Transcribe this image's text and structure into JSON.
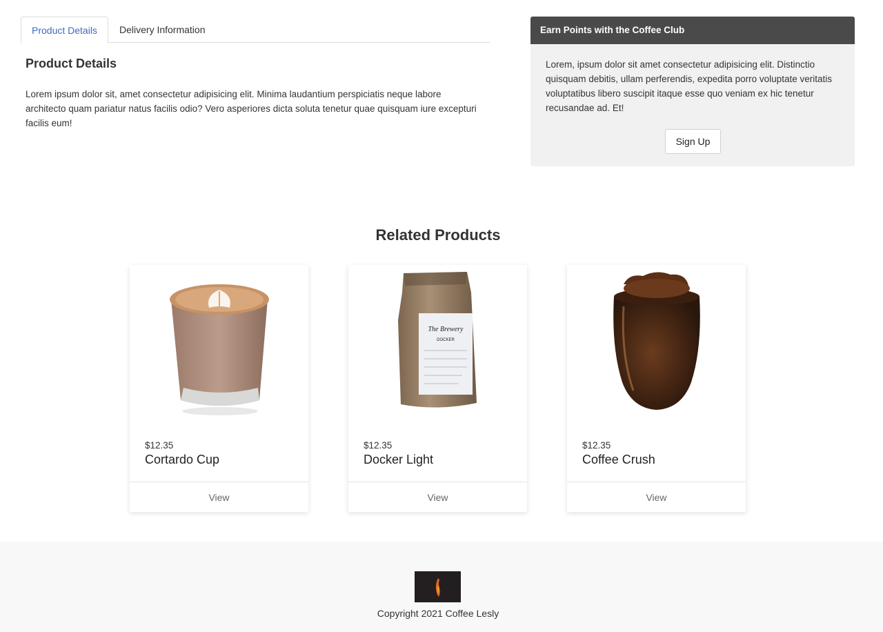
{
  "tabs": [
    {
      "label": "Product Details",
      "active": true
    },
    {
      "label": "Delivery Information",
      "active": false
    }
  ],
  "product_details": {
    "title": "Product Details",
    "text": "Lorem ipsum dolor sit, amet consectetur adipisicing elit. Minima laudantium perspiciatis neque labore architecto quam pariatur natus facilis odio? Vero asperiores dicta soluta tenetur quae quisquam iure excepturi facilis eum!"
  },
  "coffee_club": {
    "heading": "Earn Points with the Coffee Club",
    "text": "Lorem, ipsum dolor sit amet consectetur adipisicing elit. Distinctio quisquam debitis, ullam perferendis, expedita porro voluptate veritatis voluptatibus libero suscipit itaque esse quo veniam ex hic tenetur recusandae ad. Et!",
    "button_label": "Sign Up"
  },
  "related": {
    "title": "Related Products",
    "products": [
      {
        "price": "$12.35",
        "name": "Cortardo Cup",
        "view_label": "View",
        "image": "latte-glass"
      },
      {
        "price": "$12.35",
        "name": "Docker Light",
        "view_label": "View",
        "image": "coffee-bag"
      },
      {
        "price": "$12.35",
        "name": "Coffee Crush",
        "view_label": "View",
        "image": "coffee-beans-glass"
      }
    ]
  },
  "footer": {
    "copyright": "Copyright 2021 Coffee Lesly",
    "logo": "flame-logo"
  },
  "colors": {
    "accent": "#3a6dbf",
    "panel_header": "#4a4a4a",
    "panel_bg": "#f1f1f1",
    "footer_bg": "#f8f8f8"
  }
}
